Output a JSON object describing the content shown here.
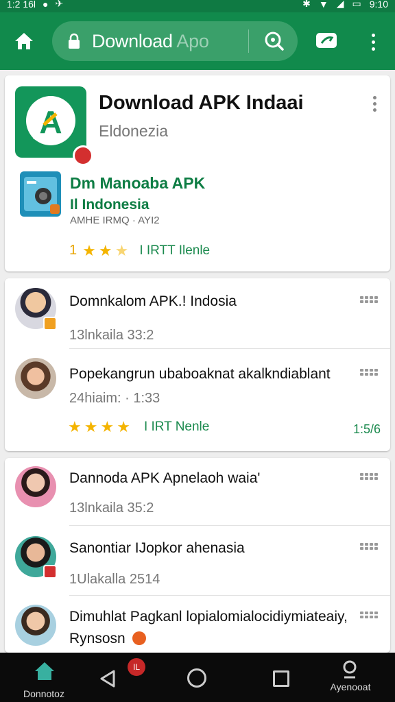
{
  "status_bar": {
    "time_left": "1:2 16l",
    "time_right": "9:10"
  },
  "browser": {
    "url_main": "Download",
    "url_dim": "Apo"
  },
  "app": {
    "title": "Download APK Indaai",
    "subtitle": "Eldonezia",
    "related_title": "Dm Manoaba APK",
    "related_subtitle": "Il Indonesia",
    "related_meta": "AMHE IRMQ · AYI2",
    "rating_value": "1",
    "stars": 2.5,
    "rating_text": "I IRTT Ilenle"
  },
  "list1": [
    {
      "title": "Domnkalom APK.! Indosia",
      "meta": "13lnkaila   33:2",
      "avatar_color": "#c9a07a",
      "badge_color": "#f0a020"
    },
    {
      "title": "Popekangrun ubaboaknat akalkndiablant",
      "meta": "24hiaim: · 1:33",
      "avatar_color": "#8a5a3c"
    }
  ],
  "list1_footer": {
    "stars": 4,
    "rating_text": "I IRT  Nenle",
    "percent": "1:5/6"
  },
  "list2": [
    {
      "title": "Dannoda APK Apnelaoh waia'",
      "meta": "13lnkaila   35:2",
      "avatar_color": "#e8a0b0"
    },
    {
      "title": "Sanontiar IJopkor ahenasia",
      "meta": "1Ulakalla   2514",
      "avatar_color": "#3fa89a",
      "badge_color": "#d32f2f"
    },
    {
      "title": "Dimuhlat Pagkanl lopialomialocidiymiateaiy,",
      "title2": "Rynsosn",
      "avatar_color": "#6da86a"
    }
  ],
  "nav": {
    "home_label": "Donnotoz",
    "badge": "IL",
    "account_label": "Ayenooat"
  },
  "colors": {
    "brand": "#118a4c",
    "link_green": "#0e7d44",
    "star": "#f4b400"
  }
}
